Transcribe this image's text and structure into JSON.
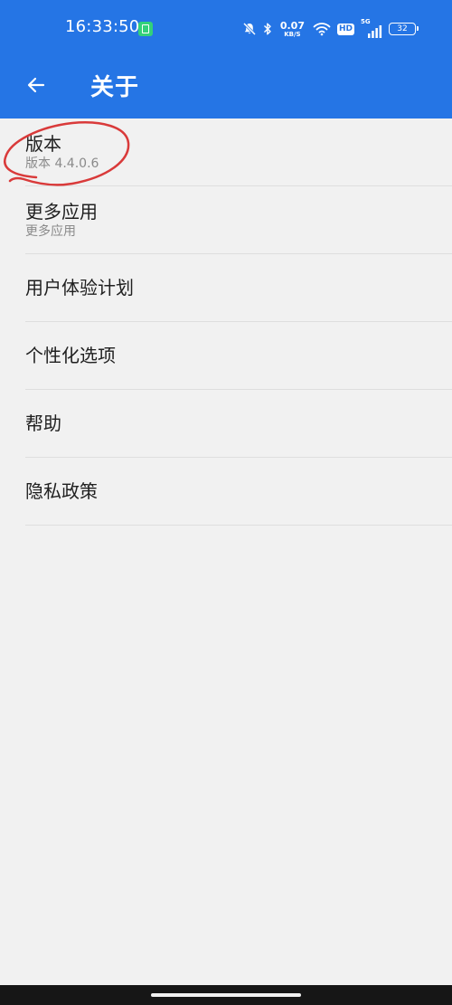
{
  "status_bar": {
    "time": "16:33:50",
    "net_speed_value": "0.07",
    "net_speed_unit": "KB/S",
    "hd_label": "HD",
    "signal_label": "5G",
    "battery_level": "32",
    "icons": [
      "app-notification-icon",
      "mute-icon",
      "bluetooth-icon",
      "wifi-icon",
      "signal-icon",
      "battery-icon"
    ]
  },
  "header": {
    "back_icon": "arrow-left-icon",
    "title": "关于",
    "background_color": "#2575e5"
  },
  "items": [
    {
      "title": "版本",
      "subtitle": "版本 4.4.0.6"
    },
    {
      "title": "更多应用",
      "subtitle": "更多应用"
    },
    {
      "title": "用户体验计划"
    },
    {
      "title": "个性化选项"
    },
    {
      "title": "帮助"
    },
    {
      "title": "隐私政策"
    }
  ],
  "annotation": {
    "type": "hand-drawn-circle",
    "color": "#d93a3a",
    "target": "items.0"
  }
}
